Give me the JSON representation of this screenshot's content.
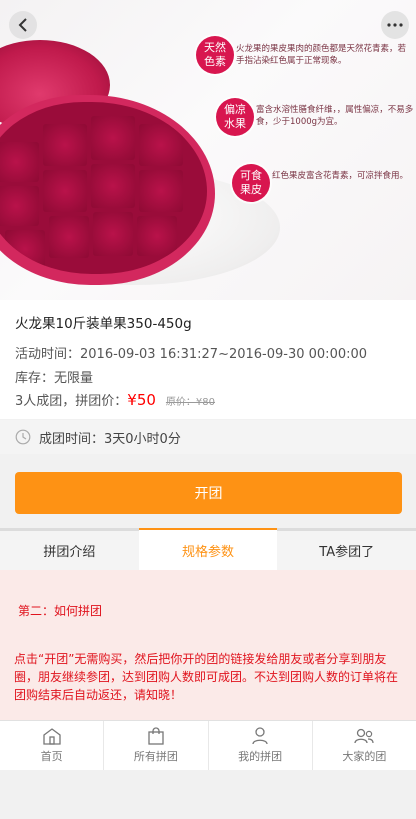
{
  "hero": {
    "callouts": [
      {
        "badge": "天然色素",
        "text": "火龙果的果皮果肉的颜色都是天然花青素，若手指沾染红色属于正常现象。"
      },
      {
        "badge": "偏凉水果",
        "text": "富含水溶性膳食纤维，，属性偏凉，不易多食，少于1000g为宜。"
      },
      {
        "badge": "可食果皮",
        "text": "红色果皮富含花青素，可凉拌食用。"
      }
    ]
  },
  "product": {
    "title": "火龙果10斤装单果350-450g",
    "activity_time": "活动时间：2016-09-03 16:31:27~2016-09-30 00:00:00",
    "stock": "库存：无限量",
    "group_label": "3人成团，拼团价：",
    "group_price": "¥50",
    "original_price": "原价：¥80",
    "form_time": "成团时间：3天0小时0分"
  },
  "actions": {
    "open_group": "开团"
  },
  "tabs": [
    "拼团介绍",
    "规格参数",
    "TA参团了"
  ],
  "content": {
    "section_title": "第二：如何拼团",
    "section_body": "点击“开团”无需购买，然后把你开的团的链接发给朋友或者分享到朋友圈，朋友继续参团，达到团购人数即可成团。不达到团购人数的订单将在团购结束后自动返还，请知晓！"
  },
  "tabbar": [
    "首页",
    "所有拼团",
    "我的拼团",
    "大家的团"
  ],
  "colors": {
    "accent": "#fe9214",
    "price": "#ff0000",
    "notice": "#e0141e",
    "badge": "#d8164f"
  }
}
